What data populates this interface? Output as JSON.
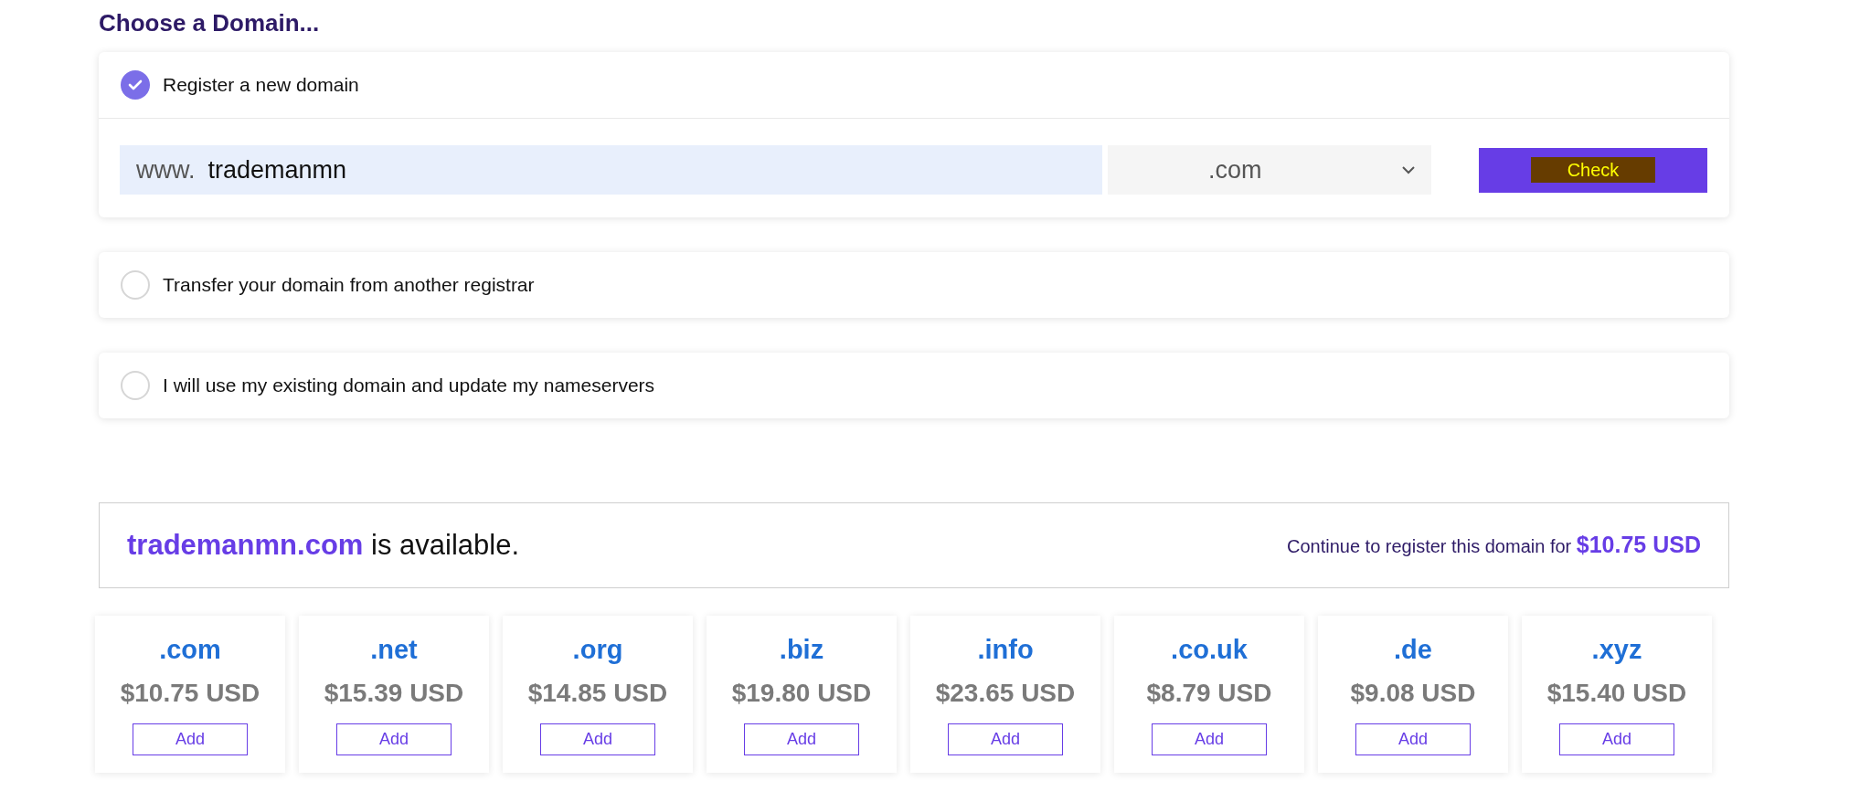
{
  "heading": "Choose a Domain...",
  "options": [
    {
      "label": "Register a new domain",
      "selected": true
    },
    {
      "label": "Transfer your domain from another registrar",
      "selected": false
    },
    {
      "label": "I will use my existing domain and update my nameservers",
      "selected": false
    }
  ],
  "domain_form": {
    "prefix": "www.",
    "value": "trademanmn",
    "tld": ".com",
    "button": "Check"
  },
  "availability": {
    "domain": "trademanmn.com",
    "status": "is available.",
    "prompt": "Continue to register this domain for",
    "price": "$10.75 USD"
  },
  "suggestions": [
    {
      "tld": ".com",
      "price": "$10.75 USD",
      "button": "Add"
    },
    {
      "tld": ".net",
      "price": "$15.39 USD",
      "button": "Add"
    },
    {
      "tld": ".org",
      "price": "$14.85 USD",
      "button": "Add"
    },
    {
      "tld": ".biz",
      "price": "$19.80 USD",
      "button": "Add"
    },
    {
      "tld": ".info",
      "price": "$23.65 USD",
      "button": "Add"
    },
    {
      "tld": ".co.uk",
      "price": "$8.79 USD",
      "button": "Add"
    },
    {
      "tld": ".de",
      "price": "$9.08 USD",
      "button": "Add"
    },
    {
      "tld": ".xyz",
      "price": "$15.40 USD",
      "button": "Add"
    }
  ]
}
